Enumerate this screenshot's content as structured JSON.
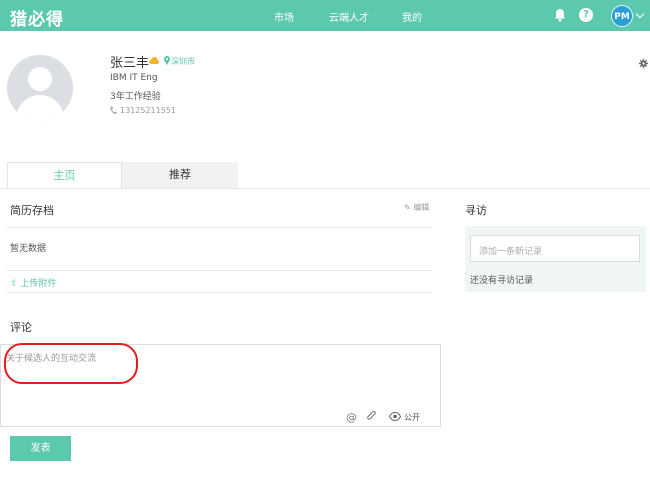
{
  "header": {
    "logo": "猎必得",
    "nav": [
      "市场",
      "云端人才",
      "我的"
    ],
    "user_initials": "PM"
  },
  "profile": {
    "name": "张三丰",
    "city": "深圳市",
    "company": "IBM IT Eng",
    "experience": "3年工作经验",
    "phone": "13125211551"
  },
  "tabs": {
    "home": "主页",
    "recommend": "推荐"
  },
  "resume": {
    "title": "简历存档",
    "edit": "编辑",
    "empty": "暂无数据",
    "upload": "上传附件"
  },
  "visit": {
    "title": "寻访",
    "placeholder": "添加一条新记录",
    "empty": "还没有寻访记录"
  },
  "comment": {
    "title": "评论",
    "placeholder": "关于候选人的互动交流",
    "visibility": "公开",
    "submit": "发表"
  },
  "colors": {
    "accent": "#5cc8ae",
    "annotation": "#e02020"
  }
}
